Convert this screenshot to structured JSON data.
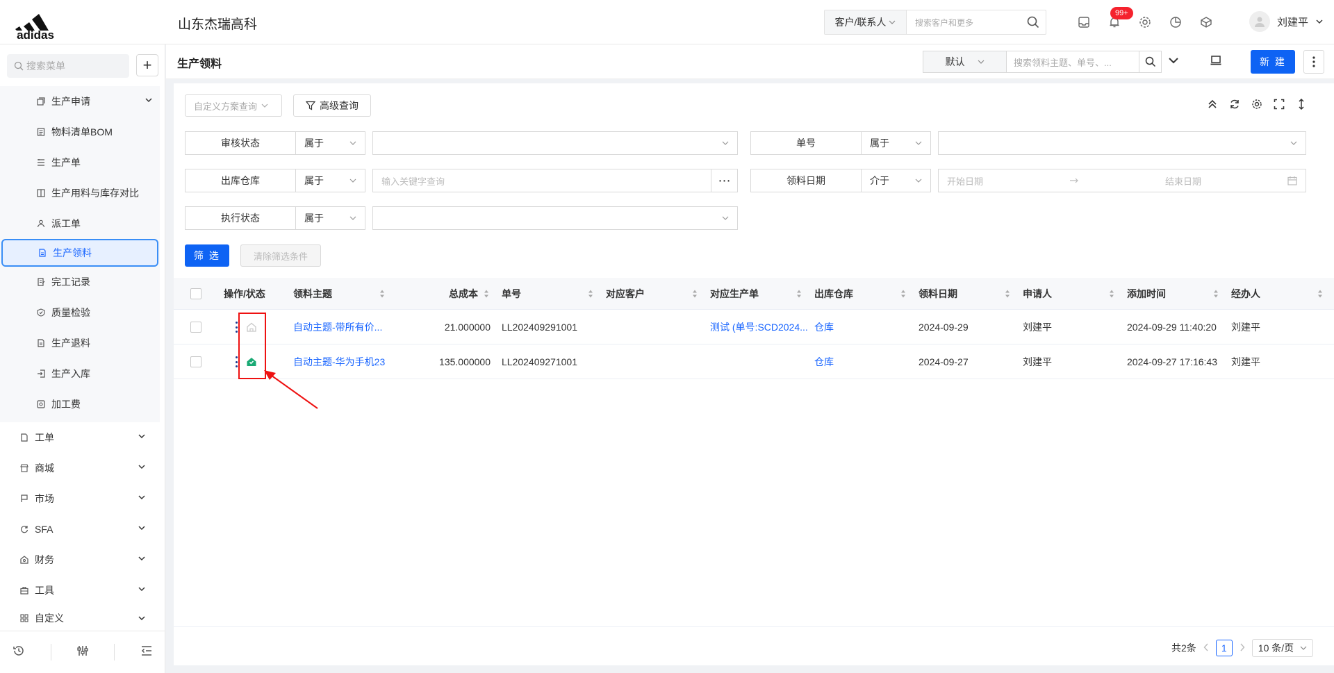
{
  "topbar": {
    "company": "山东杰瑞高科",
    "search_type": "客户/联系人",
    "search_placeholder": "搜索客户和更多",
    "notification_count": "99+",
    "user_name": "刘建平"
  },
  "sidebar": {
    "search_placeholder": "搜索菜单",
    "sub_items": [
      {
        "label": "生产申请",
        "icon": "copy-icon"
      },
      {
        "label": "物料清单BOM",
        "icon": "list-icon"
      },
      {
        "label": "生产单",
        "icon": "tasks-icon"
      },
      {
        "label": "生产用料与库存对比",
        "icon": "compare-icon"
      },
      {
        "label": "派工单",
        "icon": "worker-icon"
      },
      {
        "label": "生产领料",
        "icon": "document-icon"
      },
      {
        "label": "完工记录",
        "icon": "edit-doc-icon"
      },
      {
        "label": "质量检验",
        "icon": "shield-icon"
      },
      {
        "label": "生产退料",
        "icon": "document-icon"
      },
      {
        "label": "生产入库",
        "icon": "inbound-icon"
      },
      {
        "label": "加工费",
        "icon": "money-icon"
      }
    ],
    "top_items": [
      {
        "label": "工单",
        "icon": "ticket-icon"
      },
      {
        "label": "商城",
        "icon": "shop-icon"
      },
      {
        "label": "市场",
        "icon": "flag-icon"
      },
      {
        "label": "SFA",
        "icon": "cycle-icon"
      },
      {
        "label": "财务",
        "icon": "bank-icon"
      },
      {
        "label": "工具",
        "icon": "toolbox-icon"
      },
      {
        "label": "自定义",
        "icon": "grid-icon"
      }
    ]
  },
  "page": {
    "title": "生产领料",
    "view_select": "默认",
    "search_placeholder": "搜索领料主题、单号、...",
    "new_button": "新 建"
  },
  "filters": {
    "scheme_placeholder": "自定义方案查询",
    "advanced_label": "高级查询",
    "rows": [
      {
        "label": "审核状态",
        "op": "属于",
        "value": ""
      },
      {
        "label": "单号",
        "op": "属于",
        "value": ""
      },
      {
        "label": "出库仓库",
        "op": "属于",
        "value_placeholder": "输入关键字查询"
      },
      {
        "label": "领料日期",
        "op": "介于",
        "start_placeholder": "开始日期",
        "end_placeholder": "结束日期"
      },
      {
        "label": "执行状态",
        "op": "属于",
        "value": ""
      }
    ],
    "filter_button": "筛 选",
    "clear_button": "清除筛选条件"
  },
  "table": {
    "columns": [
      "操作/状态",
      "领料主题",
      "总成本",
      "单号",
      "对应客户",
      "对应生产单",
      "出库仓库",
      "领料日期",
      "申请人",
      "添加时间",
      "经办人"
    ],
    "rows": [
      {
        "subject": "自动主题-带所有价...",
        "cost": "21.000000",
        "no": "LL202409291001",
        "customer": "",
        "order": "测试 (单号:SCD2024...",
        "warehouse": "仓库",
        "date": "2024-09-29",
        "applicant": "刘建平",
        "added": "2024-09-29 11:40:20",
        "handler": "刘建平",
        "status_icon": "house-outline-icon"
      },
      {
        "subject": "自动主题-华为手机23",
        "cost": "135.000000",
        "no": "LL202409271001",
        "customer": "",
        "order": "",
        "warehouse": "仓库",
        "date": "2024-09-27",
        "applicant": "刘建平",
        "added": "2024-09-27 17:16:43",
        "handler": "刘建平",
        "status_icon": "house-filled-icon"
      }
    ]
  },
  "pager": {
    "total": "共2条",
    "current": "1",
    "page_size": "10 条/页"
  },
  "colors": {
    "primary": "#0e63f4",
    "link": "#1a66ff",
    "status_green": "#19a974",
    "annotation_red": "#e11111"
  }
}
